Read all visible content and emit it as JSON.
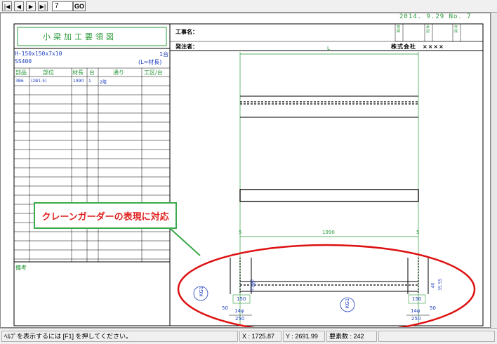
{
  "toolbar": {
    "first_icon": "first-page-icon",
    "prev_icon": "prev-page-icon",
    "next_icon": "next-page-icon",
    "last_icon": "last-page-icon",
    "page_value": "7",
    "go_label": "GO"
  },
  "header": {
    "date_line": "2014. 9.29 No. 7",
    "title": "小梁加工要領図",
    "label_project": "工事名：",
    "label_client": "発注者：",
    "company": "株式会社　××××",
    "stamp_boxes": [
      "検図",
      "承認",
      "作成"
    ]
  },
  "member": {
    "section": "H-150x150x7x10",
    "count": "1台",
    "material": "SS400",
    "length_note": "(L=材長)"
  },
  "parts_table": {
    "headers": [
      "部品",
      "部位",
      "材長",
      "台",
      "通り",
      "工区/台"
    ],
    "rows": [
      [
        "3B6",
        "(2B1-5)",
        "1990",
        "1",
        "2階",
        ""
      ]
    ]
  },
  "remarks_label": "備考",
  "drawing": {
    "top_dim": "L",
    "span_left": "5",
    "span_mid": "1990",
    "span_right": "5",
    "left_tag": "KG1",
    "center_tag": "KG1",
    "dim_150_left": "150",
    "dim_150_right": "150",
    "dim_14phi_left": "14φ",
    "dim_14phi_right": "14φ",
    "dim_250_left": "250",
    "dim_250_right": "250",
    "dim_50": "50",
    "dim_35_55": "35 55",
    "dim_40": "40"
  },
  "callout_text": "クレーンガーダーの表現に対応",
  "statusbar": {
    "help": "ﾍﾙﾌﾟを表示するには [F1] を押してください。",
    "x_coord": "X : 1725.87",
    "y_coord": "Y : 2691.99",
    "element_count": "要素数 : 242"
  },
  "colors": {
    "drawing_green": "#2a9a3a",
    "highlight_red": "#e02020",
    "callout_border": "#3aaa4a",
    "ellipse_red": "#dd1111"
  }
}
